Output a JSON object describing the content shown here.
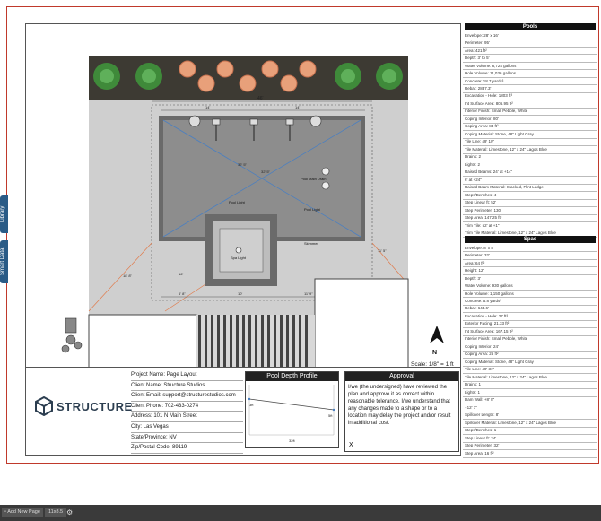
{
  "sidebar_tabs": [
    "Library",
    "Smart Data"
  ],
  "pools": {
    "title": "Pools",
    "rows": [
      "Envelope: 28' x 16'",
      "Perimeter: 95'",
      "Area: 421 ft²",
      "Depth: 3' to 5'",
      "Water Volume: 8,724 gallons",
      "Hole Volume: 11,036 gallons",
      "Concrete: 18.7 yards³",
      "Rebar: 2837.3'",
      "Excavation - Hole: 1803 ft³",
      "Int Surface Area: 806.95 ft²",
      "Interior Finish: Small Pebble, White",
      "Coping Interior: 80'",
      "Coping Area: 84 ft²",
      "Coping Material: Stone, 48\" Light Gray",
      "Tile Line: 49' 10\"",
      "Tile Material: Limestone, 12\" x 24\" Lagos Blue",
      "Drains: 2",
      "Lights: 2",
      "Raised Beams: 24' at +14\"",
      "6' at +24\"",
      "Raised Beam Material: Stacked, Flint Ledge",
      "Steps/Benches: 4",
      "Step Linear ft: 52'",
      "Step Perimeter: 130'",
      "Step Area: 147.25 ft²",
      "Trim Tile: 52' at +1\"",
      "Trim Tile Material: Limestone, 12\" x 24\" Lagos Blue"
    ]
  },
  "spas": {
    "title": "Spas",
    "rows": [
      "Envelope: 8' x 8'",
      "Perimeter: 32'",
      "Area: 64 ft²",
      "Height: 12\"",
      "Depth: 3'",
      "Water Volume: 930 gallons",
      "Hole Volume: 1,150 gallons",
      "Concrete: 5.8 yards³",
      "Rebar: 644.6'",
      "Excavation - Hole: 27 ft³",
      "Exterior Facing: 21.33 ft²",
      "Int Surface Area: 167.15 ft²",
      "Interior Finish: Small Pebble, White",
      "Coping Interior: 24'",
      "Coping Area: 26 ft²",
      "Coping Material: Stone, 48\" Light Gray",
      "Tile Line: 49' 31\"",
      "Tile Material: Limestone, 12\" x 24\" Lagos Blue",
      "Drains: 1",
      "Lights: 1",
      "Dam Wall: +8' 8\"",
      "+12' 7\"",
      "Spillover Length: 8'",
      "Spillover Material: Limestone, 12\" x 24\" Lagos Blue",
      "Steps/Benches: 1",
      "Step Linear ft: 24'",
      "Step Perimeter: 32'",
      "Step Area: 16 ft²"
    ]
  },
  "plan": {
    "labels": {
      "pool_main_drain": "Pool Main Drain",
      "pool_light_1": "Pool Light",
      "pool_light_2": "Pool Light",
      "spa_light": "Spa Light",
      "skimmer": "Skimmer",
      "dim_top": "46'",
      "dim_w1": "14'",
      "dim_w2": "14'",
      "dim_10": "10'",
      "dim_6": "6' 8\"",
      "dim_11": "11' 9\"",
      "dim_diag1": "32' 5\"",
      "dim_diag2": "32' 5\"",
      "dim_left": "18' 8\"",
      "dim_right": "11' 5\"",
      "dim_side": "16'"
    },
    "scale": "Scale: 1/8\" = 1 ft",
    "north": "N"
  },
  "titleblock": {
    "logo": "STRUCTURE",
    "project_name": "Project Name: Page Layout",
    "client_name": "Client Name: Structure Studios",
    "client_email": "Client Email: support@structurestudios.com",
    "client_phone": "Client Phone: 702-433-0274",
    "address": "Address: 101 N Main Street",
    "city": "City: Las Vegas",
    "state": "State/Province: NV",
    "zip": "Zip/Postal Code: 89119",
    "depth_profile_title": "Pool Depth Profile",
    "depth_left": "3ft",
    "depth_right": "5ft",
    "depth_length": "32ft",
    "approval_title": "Approval",
    "approval_text": "I/we (the undersigned) have reviewed the plan and approve it as correct within reasonable tolerance. I/we understand that any changes made to a shape or to a location may delay the project and/or result in additional cost.",
    "signature_x": "X"
  },
  "bottom_bar": {
    "add_page": "Add New Page",
    "page_size": "11x8.5"
  }
}
